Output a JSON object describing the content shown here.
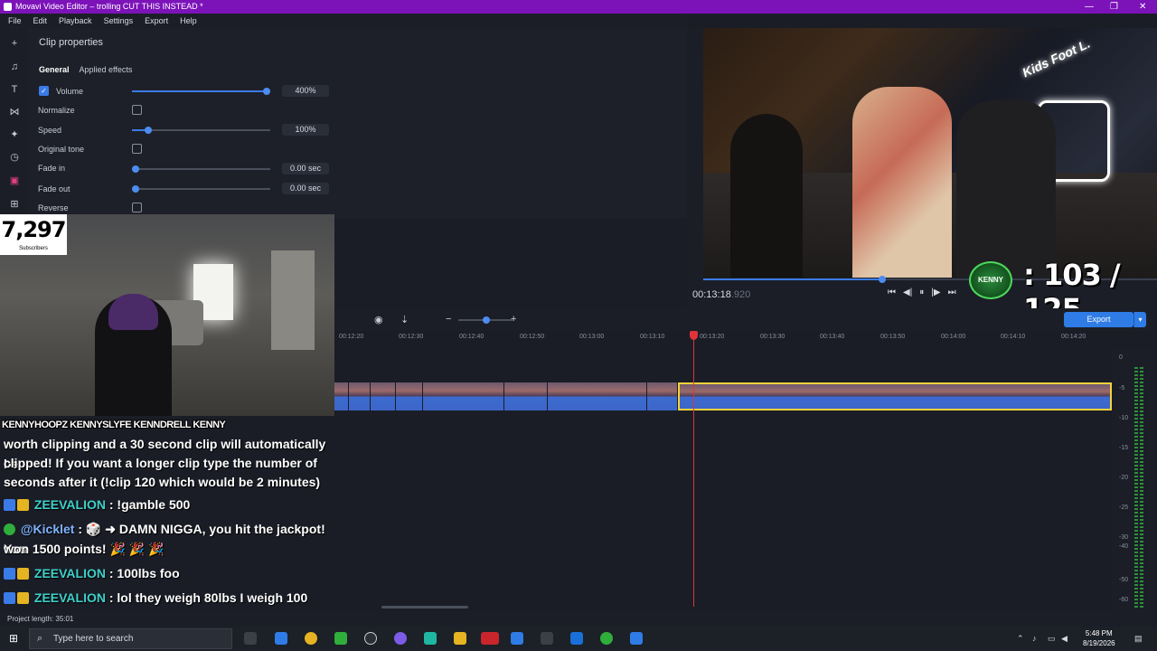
{
  "window": {
    "title": "Movavi Video Editor – trolling CUT THIS INSTEAD *"
  },
  "menu": [
    "File",
    "Edit",
    "Playback",
    "Settings",
    "Export",
    "Help"
  ],
  "clip_properties": {
    "title": "Clip properties",
    "tabs": [
      "General",
      "Applied effects"
    ],
    "volume": {
      "label": "Volume",
      "value": "400%",
      "checked": true,
      "level": 1.0
    },
    "normalize": {
      "label": "Normalize",
      "checked": false
    },
    "speed": {
      "label": "Speed",
      "value": "100%",
      "level": 0.1
    },
    "original_tone": {
      "label": "Original tone",
      "checked": false
    },
    "fade_in": {
      "label": "Fade in",
      "value": "0.00 sec",
      "level": 0
    },
    "fade_out": {
      "label": "Fade out",
      "value": "0.00 sec",
      "level": 0
    },
    "reverse": {
      "label": "Reverse",
      "checked": false
    }
  },
  "player": {
    "timecode": "00:13:18",
    "timecode_ms": ".920",
    "progress": 0.39,
    "overlay_counter": ": 103 / 125",
    "badge_text": "KENNY"
  },
  "timeline": {
    "ruler_labels": [
      "00:12:20",
      "00:12:30",
      "00:12:40",
      "00:12:50",
      "00:13:00",
      "00:13:10",
      "00:13:20",
      "00:13:30",
      "00:13:40",
      "00:13:50",
      "00:14:00",
      "00:14:10",
      "00:14:20"
    ],
    "export_label": "Export",
    "meter_labels": [
      "0",
      "-5",
      "-10",
      "-15",
      "-20",
      "-25",
      "-30",
      "-40",
      "-50",
      "-60"
    ]
  },
  "overlay": {
    "subscriber_count": "7,297",
    "subscriber_label": "Subscribers",
    "socials": "KENNYHOOPZ  KENNYSLYFE  KENNDRELL  KENNY"
  },
  "chat": {
    "intro_line1": "worth clipping and a 30 second clip will automatically be",
    "intro_line2": "clipped! If you want a longer clip type the number of",
    "intro_line3": "seconds after it (!clip 120 which would be 2 minutes)",
    "messages": [
      {
        "user": "ZEEVALION",
        "text": ": !gamble 500"
      },
      {
        "user": "@Kicklet",
        "text": ": 🎲 ➜ DAMN NIGGA, you hit the jackpot! You",
        "text2": "won 1500 points! 🎉 🎉 🎉"
      },
      {
        "user": "ZEEVALION",
        "text": ": 100lbs foo"
      },
      {
        "user": "ZEEVALION",
        "text": ": lol they weigh 80lbs I weigh 100"
      }
    ]
  },
  "status": {
    "project_length": "Project length: 35:01"
  },
  "taskbar": {
    "search_placeholder": "Type here to search",
    "time": "5:48 PM",
    "date": "8/19/2026"
  },
  "colors": {
    "titlebar": "#7c13b9",
    "accent": "#3b7be8",
    "playhead": "#e0343a",
    "selection": "#f6d23a"
  }
}
